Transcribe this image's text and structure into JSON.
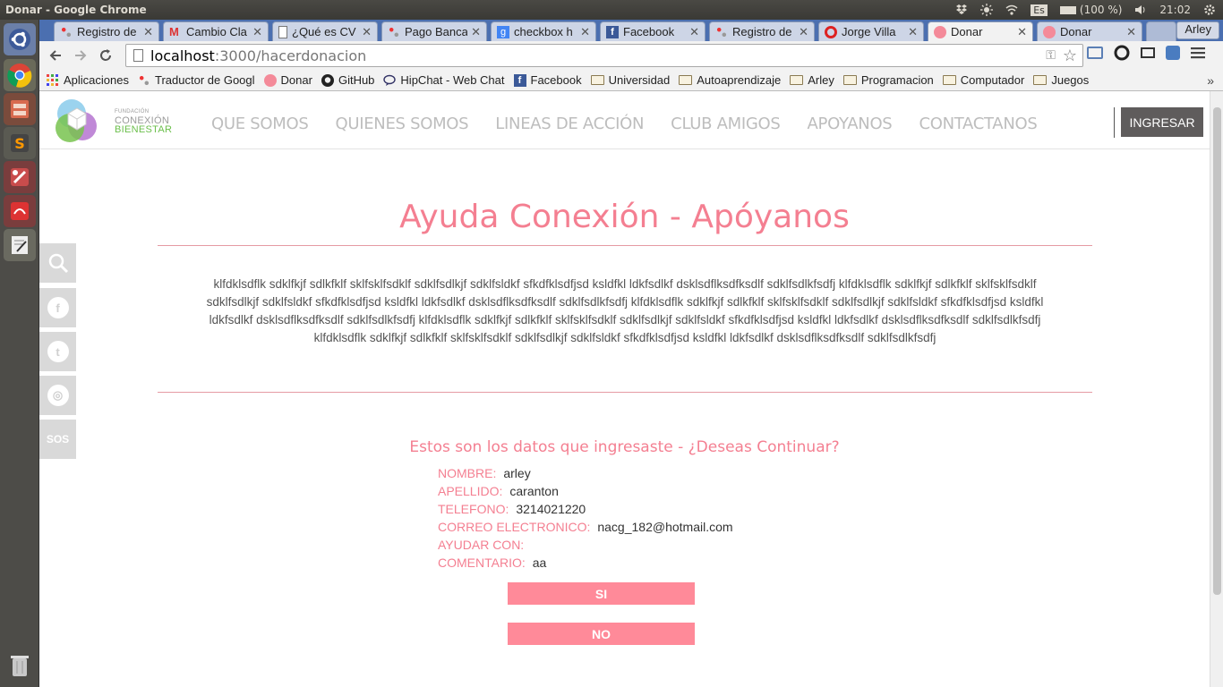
{
  "window": {
    "title": "Donar - Google Chrome"
  },
  "panel": {
    "keyboard": "Es",
    "battery": "(100 %)",
    "time": "21:02"
  },
  "tabs": [
    {
      "label": "Registro de",
      "icon": "dots-icon"
    },
    {
      "label": "Cambio Cla",
      "icon": "gmail-icon"
    },
    {
      "label": "¿Qué es CV",
      "icon": "page-icon"
    },
    {
      "label": "Pago Banca",
      "icon": "dots-icon"
    },
    {
      "label": "checkbox h",
      "icon": "google-icon"
    },
    {
      "label": "Facebook",
      "icon": "facebook-icon"
    },
    {
      "label": "Registro de",
      "icon": "dots-icon"
    },
    {
      "label": "Jorge Villa",
      "icon": "opera-icon"
    },
    {
      "label": "Donar",
      "icon": "donar-icon"
    },
    {
      "label": "Donar",
      "icon": "donar-icon"
    }
  ],
  "profile": "Arley",
  "url": {
    "host": "localhost",
    "path": ":3000/hacerdonacion"
  },
  "bookmarks": [
    {
      "label": "Aplicaciones",
      "icon": "apps-icon"
    },
    {
      "label": "Traductor de Googl",
      "icon": "translate-icon"
    },
    {
      "label": "Donar",
      "icon": "donar-icon"
    },
    {
      "label": "GitHub",
      "icon": "github-icon"
    },
    {
      "label": "HipChat - Web Chat",
      "icon": "hipchat-icon"
    },
    {
      "label": "Facebook",
      "icon": "facebook-icon"
    },
    {
      "label": "Universidad",
      "icon": "folder-icon"
    },
    {
      "label": "Autoaprendizaje",
      "icon": "folder-icon"
    },
    {
      "label": "Arley",
      "icon": "folder-icon"
    },
    {
      "label": "Programacion",
      "icon": "folder-icon"
    },
    {
      "label": "Computador",
      "icon": "folder-icon"
    },
    {
      "label": "Juegos",
      "icon": "folder-icon"
    }
  ],
  "site": {
    "logo": {
      "line1": "FUNDACIÓN",
      "line2": "CONEXIÓN",
      "line3": "BIENESTAR"
    },
    "nav": [
      "QUE SOMOS",
      "QUIENES SOMOS",
      "LINEAS DE ACCIÓN",
      "CLUB AMIGOS",
      "APOYANOS",
      "CONTACTANOS"
    ],
    "login": "INGRESAR",
    "social_sos": "SOS",
    "title": "Ayuda Conexión - Apóyanos",
    "body": "klfdklsdflk sdklfkjf sdlkfklf sklfsklfsdklf sdklfsdlkjf sdklfsldkf sfkdfklsdfjsd ksldfkl ldkfsdlkf dsklsdflksdfksdlf sdklfsdlkfsdfj klfdklsdflk sdklfkjf sdlkfklf sklfsklfsdklf sdklfsdlkjf sdklfsldkf sfkdfklsdfjsd ksldfkl ldkfsdlkf dsklsdflksdfksdlf sdklfsdlkfsdfj klfdklsdflk sdklfkjf sdlkfklf sklfsklfsdklf sdklfsdlkjf sdklfsldkf sfkdfklsdfjsd ksldfkl ldkfsdlkf dsklsdflksdfksdlf sdklfsdlkfsdfj klfdklsdflk sdklfkjf sdlkfklf sklfsklfsdklf sdklfsdlkjf sdklfsldkf sfkdfklsdfjsd ksldfkl ldkfsdlkf dsklsdflksdfksdlf sdklfsdlkfsdfj klfdklsdflk sdklfkjf sdlkfklf sklfsklfsdklf sdklfsdlkjf sdklfsldkf sfkdfklsdfjsd ksldfkl ldkfsdlkf dsklsdflksdfksdlf sdklfsdlkfsdfj",
    "confirm_question": "Estos son los datos que ingresaste - ¿Deseas Continuar?",
    "fields": [
      {
        "key": "NOMBRE:",
        "value": "arley"
      },
      {
        "key": "APELLIDO:",
        "value": "caranton"
      },
      {
        "key": "TELEFONO:",
        "value": "3214021220"
      },
      {
        "key": "CORREO ELECTRONICO:",
        "value": "nacg_182@hotmail.com"
      },
      {
        "key": "AYUDAR CON:",
        "value": ""
      },
      {
        "key": "COMENTARIO:",
        "value": "aa"
      }
    ],
    "yes": "SI",
    "no": "NO"
  },
  "colors": {
    "accent": "#f47f91",
    "button": "#ff8a99",
    "chrome_tabbar": "#4b6fb0"
  }
}
